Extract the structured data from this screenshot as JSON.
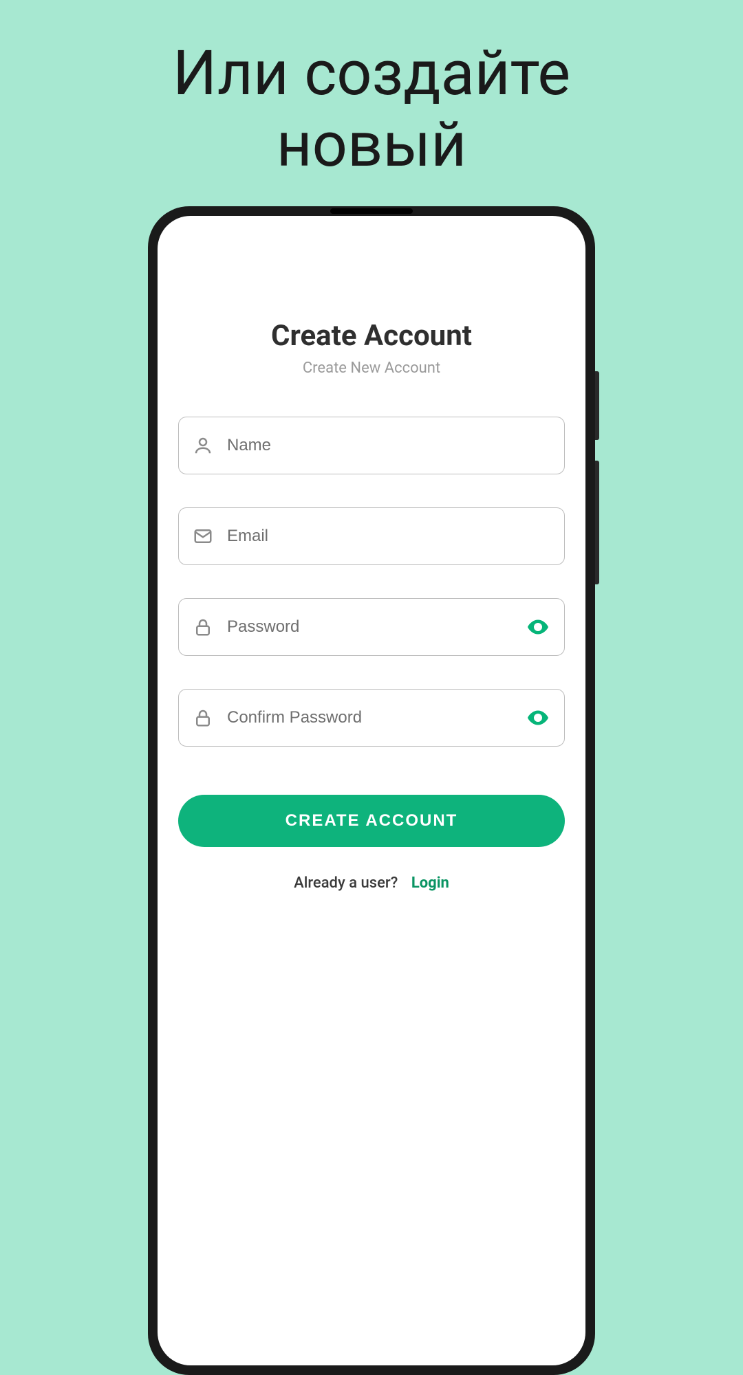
{
  "promo": {
    "line1": "Или создайте",
    "line2": "новый"
  },
  "screen": {
    "title": "Create Account",
    "subtitle": "Create New Account",
    "fields": {
      "name": {
        "placeholder": "Name",
        "value": ""
      },
      "email": {
        "placeholder": "Email",
        "value": ""
      },
      "pass": {
        "placeholder": "Password",
        "value": ""
      },
      "confirm": {
        "placeholder": "Confirm Password",
        "value": ""
      }
    },
    "submit_label": "CREATE ACCOUNT",
    "footer": {
      "prompt": "Already a user?",
      "login": "Login"
    }
  },
  "colors": {
    "accent": "#0eb37c",
    "bg": "#a7e8d1"
  }
}
